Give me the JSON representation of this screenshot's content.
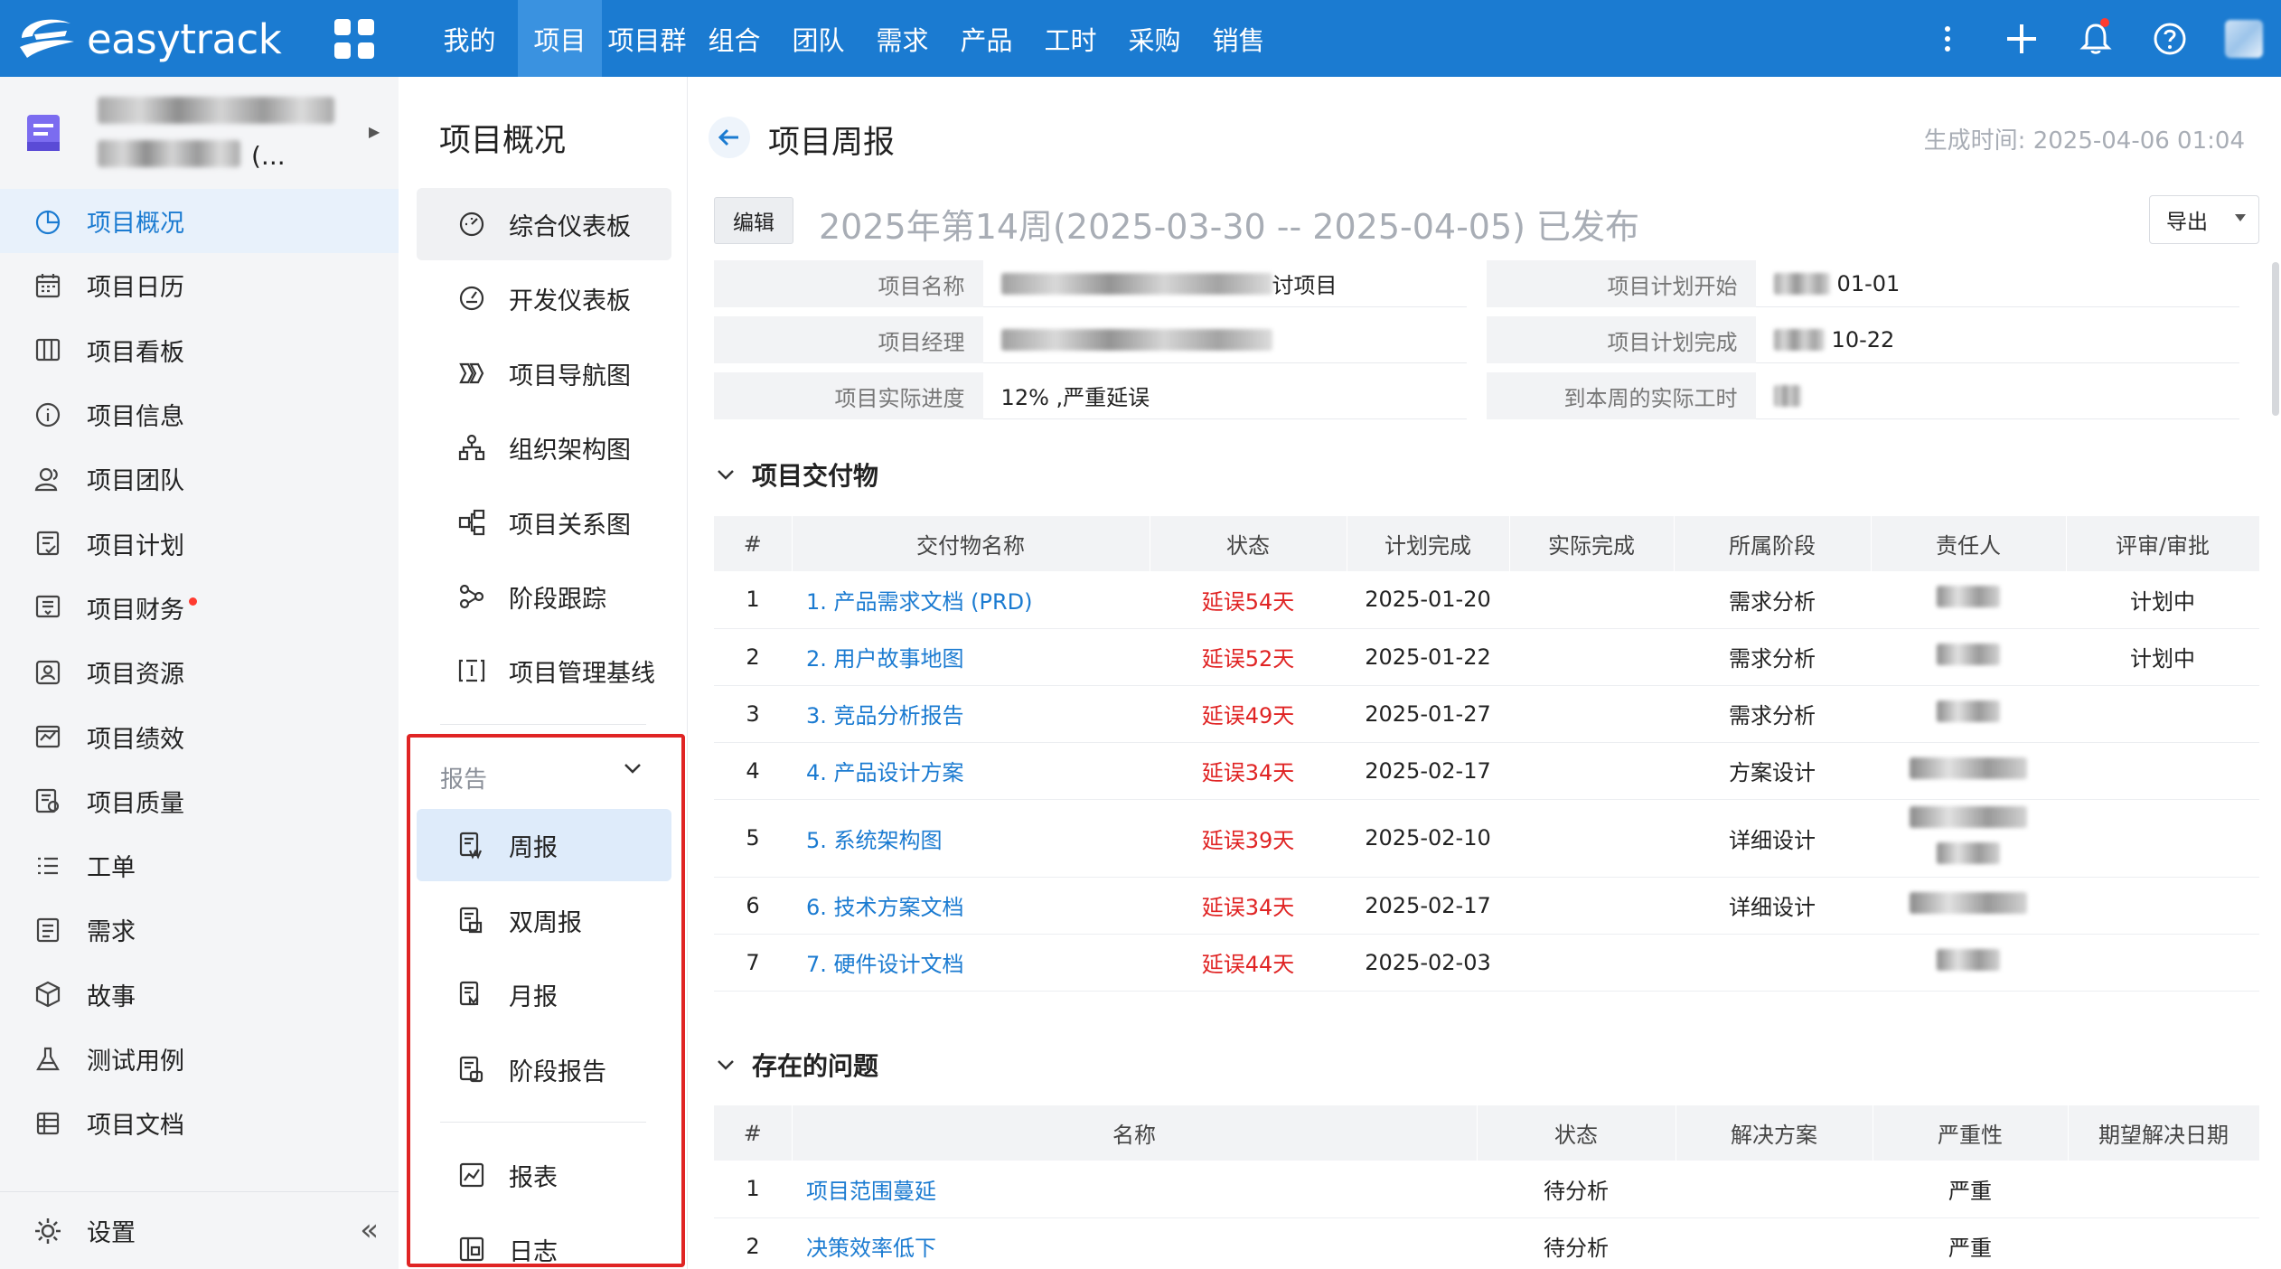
{
  "app": {
    "name": "easytrack"
  },
  "topnav": {
    "items": [
      {
        "label": "我的",
        "active": false
      },
      {
        "label": "项目",
        "active": true
      },
      {
        "label": "项目群",
        "active": false
      },
      {
        "label": "组合",
        "active": false
      },
      {
        "label": "团队",
        "active": false
      },
      {
        "label": "需求",
        "active": false
      },
      {
        "label": "产品",
        "active": false
      },
      {
        "label": "工时",
        "active": false
      },
      {
        "label": "采购",
        "active": false
      },
      {
        "label": "销售",
        "active": false
      }
    ],
    "brand_color": "#1b7bd1"
  },
  "sidebar": {
    "project_name_suffix": "(...",
    "items": [
      {
        "label": "项目概况",
        "icon": "pie-chart-icon",
        "active": true
      },
      {
        "label": "项目日历",
        "icon": "calendar-icon"
      },
      {
        "label": "项目看板",
        "icon": "kanban-icon"
      },
      {
        "label": "项目信息",
        "icon": "info-icon"
      },
      {
        "label": "项目团队",
        "icon": "team-icon"
      },
      {
        "label": "项目计划",
        "icon": "plan-icon"
      },
      {
        "label": "项目财务",
        "icon": "finance-icon",
        "badge": true
      },
      {
        "label": "项目资源",
        "icon": "resource-icon"
      },
      {
        "label": "项目绩效",
        "icon": "performance-icon"
      },
      {
        "label": "项目质量",
        "icon": "quality-icon"
      },
      {
        "label": "工单",
        "icon": "ticket-icon"
      },
      {
        "label": "需求",
        "icon": "requirement-icon"
      },
      {
        "label": "故事",
        "icon": "story-icon"
      },
      {
        "label": "测试用例",
        "icon": "test-case-icon"
      },
      {
        "label": "项目文档",
        "icon": "document-icon"
      }
    ],
    "settings_label": "设置"
  },
  "subnav": {
    "title": "项目概况",
    "items": [
      {
        "label": "综合仪表板",
        "icon": "dashboard-icon"
      },
      {
        "label": "开发仪表板",
        "icon": "dev-dashboard-icon"
      },
      {
        "label": "项目导航图",
        "icon": "navigation-icon"
      },
      {
        "label": "组织架构图",
        "icon": "org-chart-icon"
      },
      {
        "label": "项目关系图",
        "icon": "relation-icon"
      },
      {
        "label": "阶段跟踪",
        "icon": "stage-track-icon"
      },
      {
        "label": "项目管理基线",
        "icon": "baseline-icon"
      }
    ],
    "report_group_label": "报告",
    "report_items": [
      {
        "label": "周报",
        "icon": "weekly-report-icon",
        "active": true
      },
      {
        "label": "双周报",
        "icon": "biweekly-report-icon"
      },
      {
        "label": "月报",
        "icon": "monthly-report-icon"
      },
      {
        "label": "阶段报告",
        "icon": "stage-report-icon"
      }
    ],
    "extra_items": [
      {
        "label": "报表",
        "icon": "report-chart-icon"
      },
      {
        "label": "日志",
        "icon": "log-icon"
      }
    ]
  },
  "main": {
    "page_title": "项目周报",
    "generated_time": "生成时间: 2025-04-06 01:04",
    "edit_label": "编辑",
    "week_title": "2025年第14周(2025-03-30 -- 2025-04-05) 已发布",
    "export_label": "导出",
    "info": {
      "project_name_label": "项目名称",
      "project_name_suffix": "讨项目",
      "plan_start_label": "项目计划开始",
      "plan_start_value": "01-01",
      "manager_label": "项目经理",
      "plan_end_label": "项目计划完成",
      "plan_end_value": "10-22",
      "progress_label": "项目实际进度",
      "progress_value": "12% ,严重延误",
      "actual_hours_label": "到本周的实际工时"
    },
    "deliverables": {
      "title": "项目交付物",
      "headers": [
        "#",
        "交付物名称",
        "状态",
        "计划完成",
        "实际完成",
        "所属阶段",
        "责任人",
        "评审/审批"
      ],
      "rows": [
        {
          "no": "1",
          "name": "1. 产品需求文档 (PRD)",
          "status": "延误54天",
          "planned": "2025-01-20",
          "actual": "",
          "stage": "需求分析",
          "review": "计划中"
        },
        {
          "no": "2",
          "name": "2. 用户故事地图",
          "status": "延误52天",
          "planned": "2025-01-22",
          "actual": "",
          "stage": "需求分析",
          "review": "计划中"
        },
        {
          "no": "3",
          "name": "3. 竞品分析报告",
          "status": "延误49天",
          "planned": "2025-01-27",
          "actual": "",
          "stage": "需求分析",
          "review": ""
        },
        {
          "no": "4",
          "name": "4. 产品设计方案",
          "status": "延误34天",
          "planned": "2025-02-17",
          "actual": "",
          "stage": "方案设计",
          "review": ""
        },
        {
          "no": "5",
          "name": "5. 系统架构图",
          "status": "延误39天",
          "planned": "2025-02-10",
          "actual": "",
          "stage": "详细设计",
          "review": ""
        },
        {
          "no": "6",
          "name": "6. 技术方案文档",
          "status": "延误34天",
          "planned": "2025-02-17",
          "actual": "",
          "stage": "详细设计",
          "review": ""
        },
        {
          "no": "7",
          "name": "7. 硬件设计文档",
          "status": "延误44天",
          "planned": "2025-02-03",
          "actual": "",
          "stage": "",
          "review": ""
        }
      ]
    },
    "issues": {
      "title": "存在的问题",
      "headers": [
        "#",
        "名称",
        "状态",
        "解决方案",
        "严重性",
        "期望解决日期"
      ],
      "rows": [
        {
          "no": "1",
          "name": "项目范围蔓延",
          "status": "待分析",
          "solution": "",
          "severity": "严重",
          "expected": ""
        },
        {
          "no": "2",
          "name": "决策效率低下",
          "status": "待分析",
          "solution": "",
          "severity": "严重",
          "expected": ""
        }
      ]
    }
  }
}
